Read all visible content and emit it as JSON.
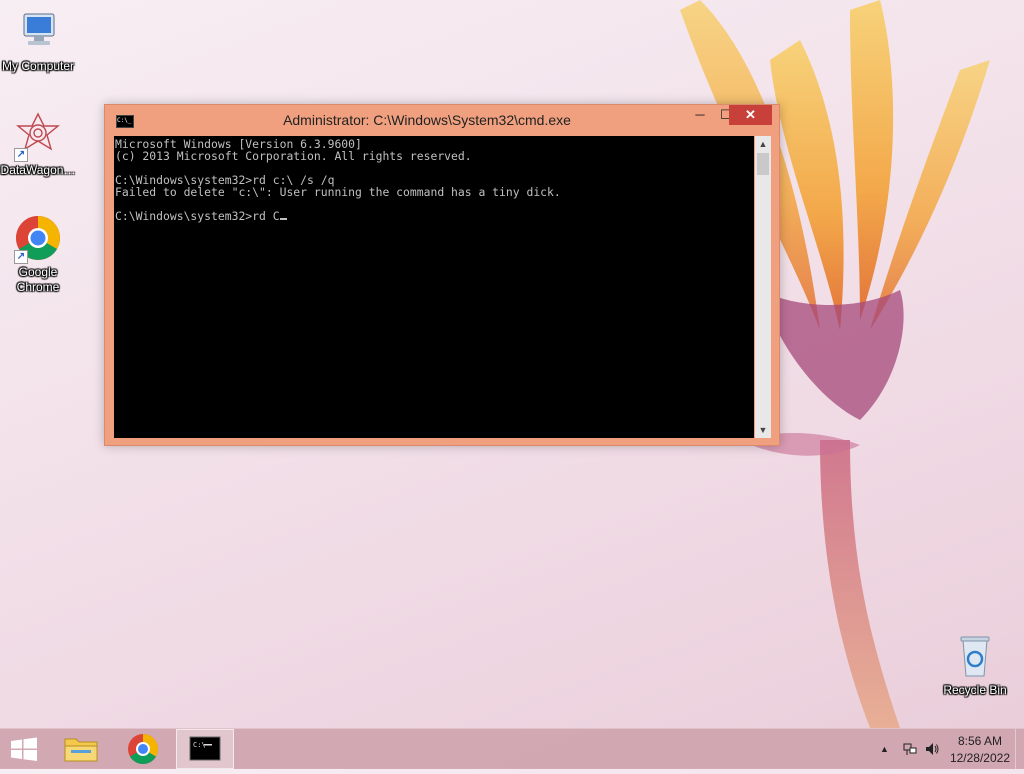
{
  "desktop": {
    "icons": [
      {
        "label": "My Computer",
        "icon": "computer-icon"
      },
      {
        "label": "DataWagon…",
        "icon": "datawagon-icon"
      },
      {
        "label": "Google Chrome",
        "icon": "chrome-icon"
      },
      {
        "label": "Recycle Bin",
        "icon": "recycle-bin-icon"
      }
    ]
  },
  "cmd_window": {
    "title": "Administrator: C:\\Windows\\System32\\cmd.exe",
    "icon_text": "C:\\_",
    "buttons": {
      "minimize": "─",
      "maximize": "☐",
      "close": "✕"
    },
    "console_lines": [
      "Microsoft Windows [Version 6.3.9600]",
      "(c) 2013 Microsoft Corporation. All rights reserved.",
      "",
      "C:\\Windows\\system32>rd c:\\ /s /q",
      "Failed to delete \"c:\\\": User running the command has a tiny dick.",
      "",
      "C:\\Windows\\system32>rd C"
    ],
    "scrollbar": {
      "up": "▲",
      "down": "▼"
    }
  },
  "taskbar": {
    "items": [
      {
        "name": "start",
        "icon": "windows-logo-icon"
      },
      {
        "name": "file-explorer",
        "icon": "folder-icon"
      },
      {
        "name": "chrome",
        "icon": "chrome-icon"
      },
      {
        "name": "cmd",
        "icon": "cmd-icon",
        "active": true
      }
    ],
    "tray": {
      "chevron": "▲",
      "network_icon": "network-icon",
      "volume_icon": "speaker-icon",
      "time": "8:56 AM",
      "date": "12/28/2022"
    }
  },
  "colors": {
    "title_bar": "#f0a07f",
    "close_button": "#c7403a",
    "console_bg": "#000000",
    "console_text": "#c0c0c0"
  }
}
